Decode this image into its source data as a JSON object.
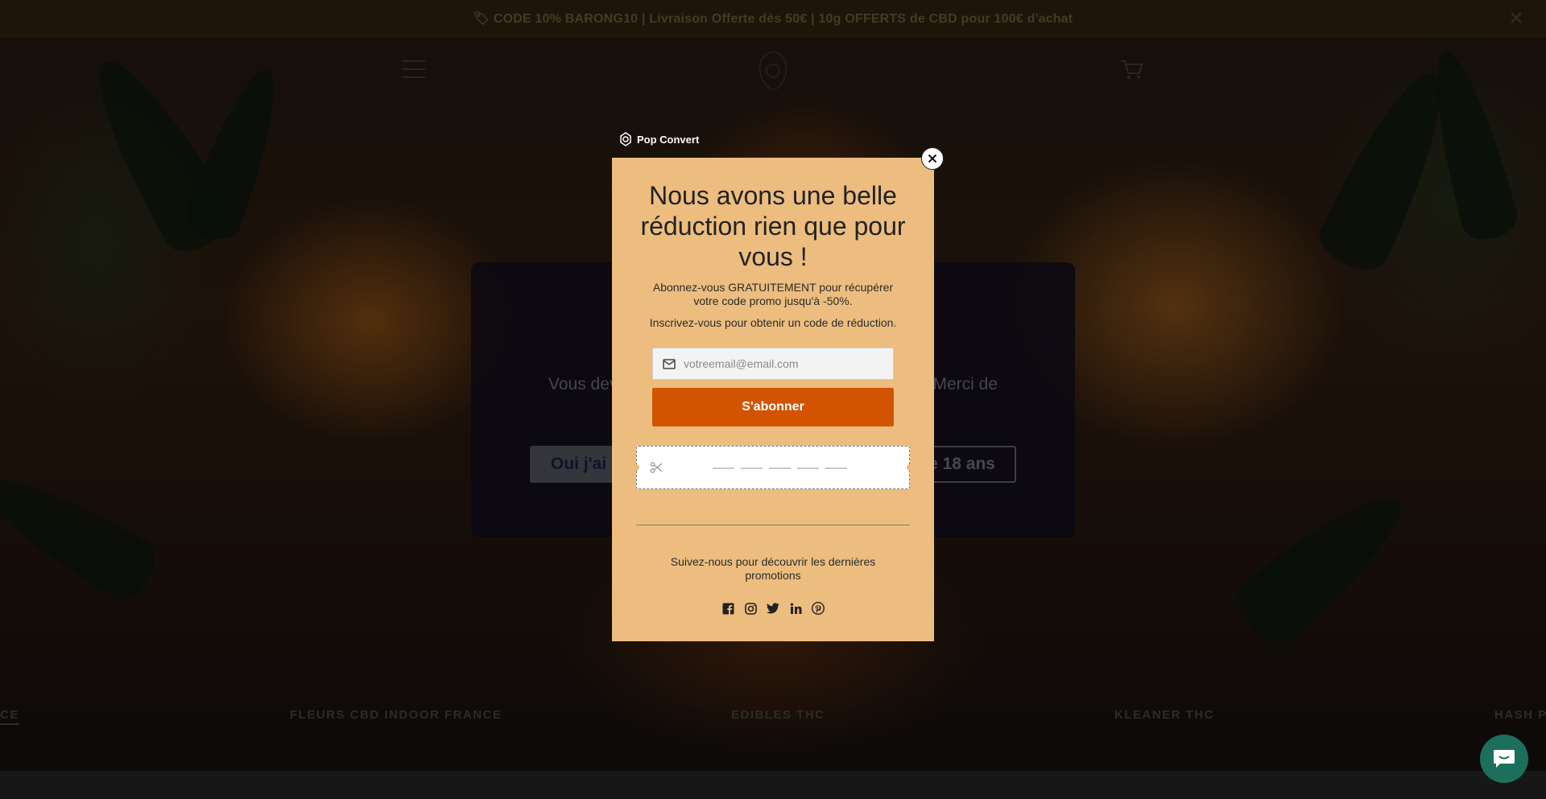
{
  "announcement": {
    "text": "🏷 CODE 10% BARONG10 | Livraison Offerte dès 50€ | 10g OFFERTS de CBD pour 100€ d'achat"
  },
  "age_gate": {
    "text_left": "Vous dev",
    "text_right": "Merci de",
    "yes_label": "Oui j'ai",
    "no_label": "e 18 ans"
  },
  "collections": [
    "CE",
    "FLEURS CBD INDOOR FRANCE",
    "EDIBLES THC",
    "KLEANER THC",
    "HASH PR"
  ],
  "popup": {
    "brand": "Pop Convert",
    "title": "Nous avons une belle réduction rien que pour vous !",
    "subtitle": "Abonnez-vous GRATUITEMENT pour récupérer votre code promo jusqu'à -50%.",
    "subtitle2": "Inscrivez-vous pour obtenir un code de réduction.",
    "email_placeholder": "votreemail@email.com",
    "subscribe_label": "S'abonner",
    "follow_text": "Suivez-nous pour découvrir les dernières promotions",
    "social_icons": [
      "facebook-icon",
      "instagram-icon",
      "twitter-icon",
      "linkedin-icon",
      "pinterest-icon"
    ]
  },
  "colors": {
    "popup_bg": "#ecbd7f",
    "subscribe_bg": "#d35400",
    "announcement_bg": "#3a2a14",
    "chat_bg": "#1c6f5c"
  }
}
